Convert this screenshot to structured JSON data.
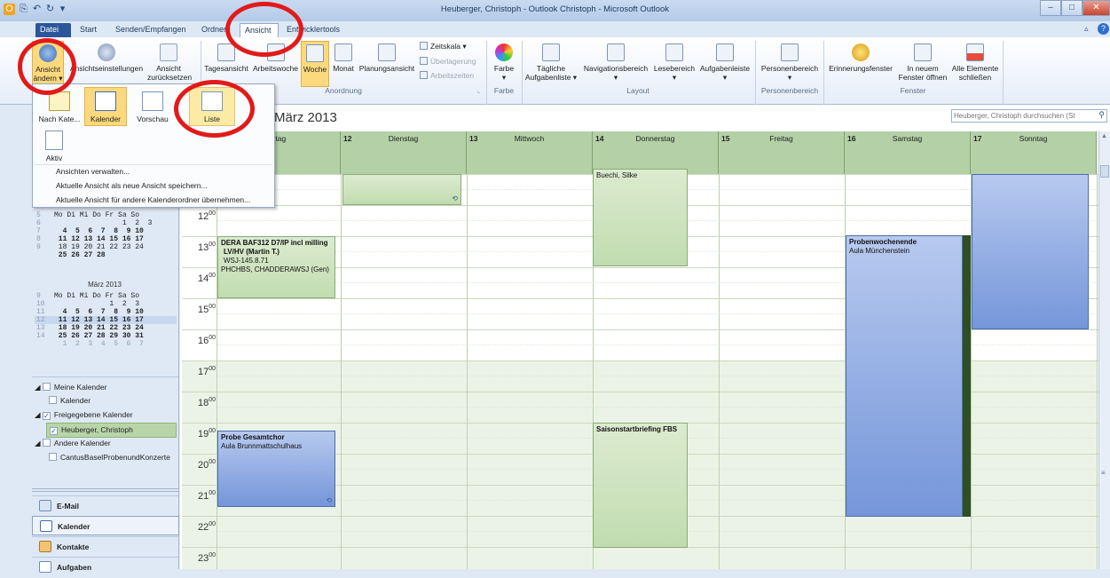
{
  "window": {
    "title": "Heuberger, Christoph - Outlook Christoph - Microsoft Outlook"
  },
  "tabs": [
    {
      "label": "Datei"
    },
    {
      "label": "Start"
    },
    {
      "label": "Senden/Empfangen"
    },
    {
      "label": "Ordner"
    },
    {
      "label": "Ansicht"
    },
    {
      "label": "Entwicklertools"
    }
  ],
  "ribbon": {
    "ansicht_aendern": "Ansicht ändern",
    "ansichtseinstellungen": "Ansichtseinstellungen",
    "ansicht_zuruecksetzen": "Ansicht zurücksetzen",
    "tagesansicht": "Tagesansicht",
    "arbeitswoche": "Arbeitswoche",
    "woche": "Woche",
    "monat": "Monat",
    "planungsansicht": "Planungsansicht",
    "zeitskala": "Zeitskala",
    "ueberlagerung": "Überlagerung",
    "arbeitszeiten": "Arbeitszeiten",
    "farbe": "Farbe",
    "taegliche_aufgabenliste": "Tägliche Aufgabenliste",
    "navigationsbereich": "Navigationsbereich",
    "lesebereich": "Lesebereich",
    "aufgabenleiste": "Aufgabenleiste",
    "personenbereich": "Personenbereich",
    "erinnerungsfenster": "Erinnerungsfenster",
    "in_neuem_fenster": "In neuem Fenster öffnen",
    "alle_elemente_schliessen": "Alle Elemente schließen",
    "grp_anordnung": "Anordnung",
    "grp_farbe": "Farbe",
    "grp_layout": "Layout",
    "grp_personenbereich": "Personenbereich",
    "grp_fenster": "Fenster"
  },
  "dropdown": {
    "nach_kategorie": "Nach Kate...",
    "kalender": "Kalender",
    "vorschau": "Vorschau",
    "liste": "Liste",
    "aktiv": "Aktiv",
    "menu": [
      "Ansichten verwalten...",
      "Aktuelle Ansicht als neue Ansicht speichern...",
      "Aktuelle Ansicht für andere Kalenderordner übernehmen..."
    ]
  },
  "calendar": {
    "title": "März 2013",
    "search_placeholder": "Heuberger, Christoph durchsuchen (St",
    "days": [
      {
        "num": "",
        "name": "ntag"
      },
      {
        "num": "12",
        "name": "Dienstag"
      },
      {
        "num": "13",
        "name": "Mittwoch"
      },
      {
        "num": "14",
        "name": "Donnerstag"
      },
      {
        "num": "15",
        "name": "Freitag"
      },
      {
        "num": "16",
        "name": "Samstag"
      },
      {
        "num": "17",
        "name": "Sonntag"
      }
    ],
    "hours": [
      "12",
      "13",
      "14",
      "15",
      "16",
      "17",
      "18",
      "19",
      "20",
      "21",
      "22",
      "23"
    ],
    "appointments": {
      "dera_title": "DERA BAF312 D7/IP incl milling",
      "dera_line2": "LV/HV (Martin T.)",
      "dera_line3": "WSJ-145.8.71",
      "dera_line4": "PHCHBS, CHADDERAWSJ (Gen)",
      "buechi": "Buechi, Silke",
      "probe_title": "Probe Gesamtchor",
      "probe_loc": "Aula Brunnmattschulhaus",
      "saison": "Saisonstartbriefing FBS",
      "wochenende_title": "Probenwochenende",
      "wochenende_loc": "Aula Münchenstein"
    }
  },
  "minical": {
    "feb_rows": [
      "Mo Di Mi Do Fr Sa So",
      "                1  2  3",
      "  4  5  6  7  8  9 10",
      " 11 12 13 14 15 16 17",
      " 18 19 20 21 22 23 24",
      " 25 26 27 28"
    ],
    "feb_weeks": [
      "",
      "5",
      "6",
      "7",
      "8",
      "9"
    ],
    "mar_title": "März 2013",
    "mar_rows": [
      "Mo Di Mi Do Fr Sa So",
      "             1  2  3",
      "  4  5  6  7  8  9 10",
      " 11 12 13 14 15 16 17",
      " 18 19 20 21 22 23 24",
      " 25 26 27 28 29 30 31",
      "  1  2  3  4  5  6  7"
    ],
    "mar_weeks": [
      "",
      "9",
      "10",
      "11",
      "12",
      "13",
      "14"
    ]
  },
  "folders": {
    "meine_kalender": "Meine Kalender",
    "kalender": "Kalender",
    "freigegebene": "Freigegebene Kalender",
    "heuberger": "Heuberger, Christoph",
    "andere": "Andere Kalender",
    "cantus": "CantusBaselProbenundKonzerte"
  },
  "nav": {
    "email": "E-Mail",
    "kalender": "Kalender",
    "kontakte": "Kontakte",
    "aufgaben": "Aufgaben"
  },
  "colors": {
    "accent_red": "#e21a1a",
    "appt_green": "#c1dcb0",
    "appt_blue": "#7596da",
    "header_green": "#b3d0a6"
  }
}
